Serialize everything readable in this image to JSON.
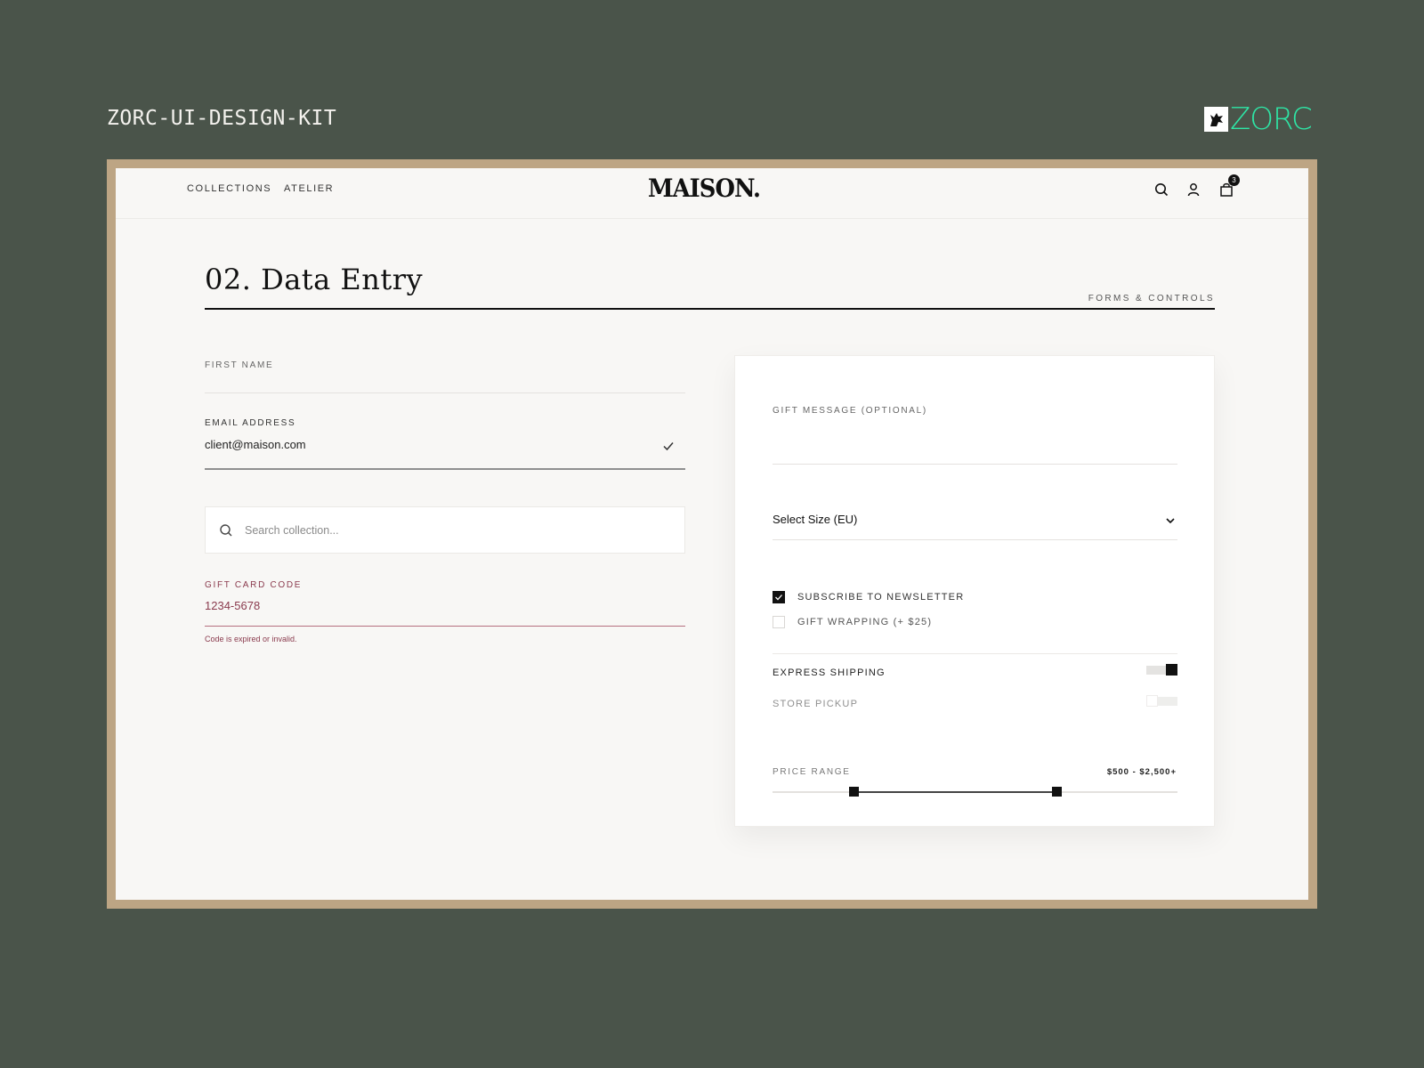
{
  "kit": {
    "title": "ZORC-UI-DESIGN-KIT",
    "brand_name": "ZORC",
    "brand_color": "#2ee6a6"
  },
  "nav": {
    "links": [
      "COLLECTIONS",
      "ATELIER"
    ],
    "logo": "MAISON.",
    "icons": [
      "search-icon",
      "user-icon",
      "shopping-bag-icon"
    ],
    "cart_count": "3"
  },
  "section": {
    "title": "02. Data Entry",
    "tag": "FORMS & CONTROLS"
  },
  "form": {
    "first_name": {
      "label": "FIRST NAME",
      "value": ""
    },
    "email": {
      "label": "EMAIL ADDRESS",
      "value": "client@maison.com",
      "status": "valid"
    },
    "search": {
      "placeholder": "Search collection..."
    },
    "gift_card": {
      "label": "GIFT CARD CODE",
      "value": "1234-5678",
      "error": "Code is expired or invalid.",
      "error_color": "#8a3a4d"
    }
  },
  "panel": {
    "gift_message": {
      "label": "GIFT MESSAGE (OPTIONAL)",
      "value": ""
    },
    "size_select": {
      "value": "Select Size (EU)"
    },
    "checkboxes": [
      {
        "label": "SUBSCRIBE TO NEWSLETTER",
        "checked": true
      },
      {
        "label": "GIFT WRAPPING (+ $25)",
        "checked": false
      }
    ],
    "toggles": [
      {
        "label": "EXPRESS SHIPPING",
        "on": true
      },
      {
        "label": "STORE PICKUP",
        "on": false,
        "disabled": true
      }
    ],
    "price_range": {
      "label": "PRICE RANGE",
      "value_text": "$500 - $2,500+",
      "low_fraction": 0.2,
      "high_fraction": 0.7
    }
  },
  "colors": {
    "background": "#4a544a",
    "frame": "#bda584",
    "page": "#f8f7f5",
    "ink": "#111111"
  }
}
